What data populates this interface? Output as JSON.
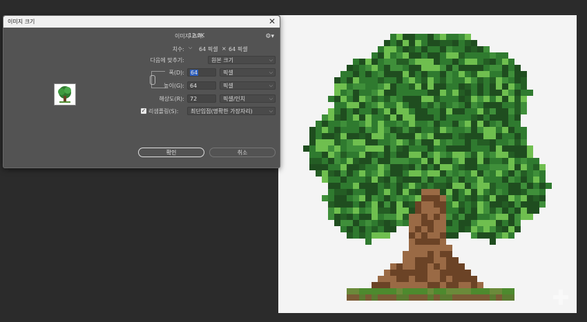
{
  "dialog": {
    "title": "이미지 크기",
    "close_label": "✕",
    "image_size_label": "이미지 크기:",
    "image_size_value": "12.0K",
    "dimensions_label": "치수:",
    "dimensions_w": "64 픽셀",
    "dimensions_x": "×",
    "dimensions_h": "64 픽셀",
    "fit_to_label": "다음에 맞추기:",
    "fit_to_value": "원본 크기",
    "width_label": "폭(D):",
    "width_value": "64",
    "width_unit": "픽셀",
    "height_label": "높이(G):",
    "height_value": "64",
    "height_unit": "픽셀",
    "resolution_label": "해상도(R):",
    "resolution_value": "72",
    "resolution_unit": "픽셀/인치",
    "resample_label": "리샘플링(S):",
    "resample_checked": true,
    "resample_value": "최단입점(명확한 가장자리)",
    "ok_label": "확인",
    "cancel_label": "취소"
  },
  "icons": {
    "gear": "gear-icon",
    "close": "close-icon",
    "chain": "link-chain-icon",
    "chevron": "chevron-down-icon"
  },
  "colors": {
    "background": "#2b2b2b",
    "dialog": "#535353",
    "accent": "#2d5fbf",
    "tree_leaf_dark": "#1f4d1f",
    "tree_leaf": "#2f7a2f",
    "tree_leaf_light": "#6fbf4f",
    "tree_trunk": "#6b4326",
    "tree_trunk_light": "#9a6a45",
    "grass": "#4d8a2e"
  }
}
